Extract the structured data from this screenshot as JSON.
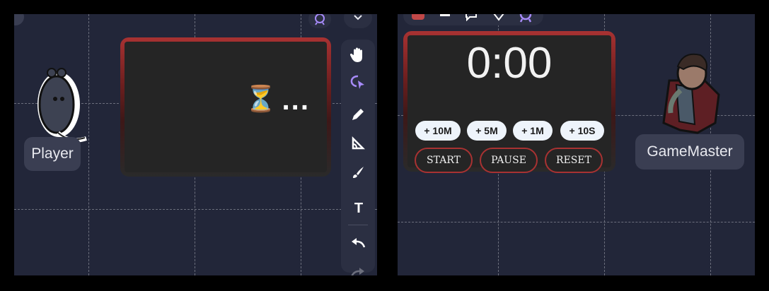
{
  "left_scene": {
    "player_label": "Player",
    "pending_timer": {
      "hourglass": "⏳",
      "ellipsis": "..."
    }
  },
  "toolbar": {
    "tools": [
      "hand-icon",
      "select-lasso-icon",
      "pen-icon",
      "measure-icon",
      "brush-icon",
      "text-icon",
      "undo-icon",
      "redo-icon"
    ],
    "text_tool_label": "T"
  },
  "right_scene": {
    "gm_label": "GameMaster",
    "timer": {
      "display": "0:00",
      "increments": [
        "+ 10M",
        "+ 5M",
        "+ 1M",
        "+ 10S"
      ],
      "controls": [
        "START",
        "PAUSE",
        "RESET"
      ]
    }
  },
  "colors": {
    "canvas": "#222639",
    "accent_red": "#a83232",
    "tool_purple": "#a78bfa"
  }
}
